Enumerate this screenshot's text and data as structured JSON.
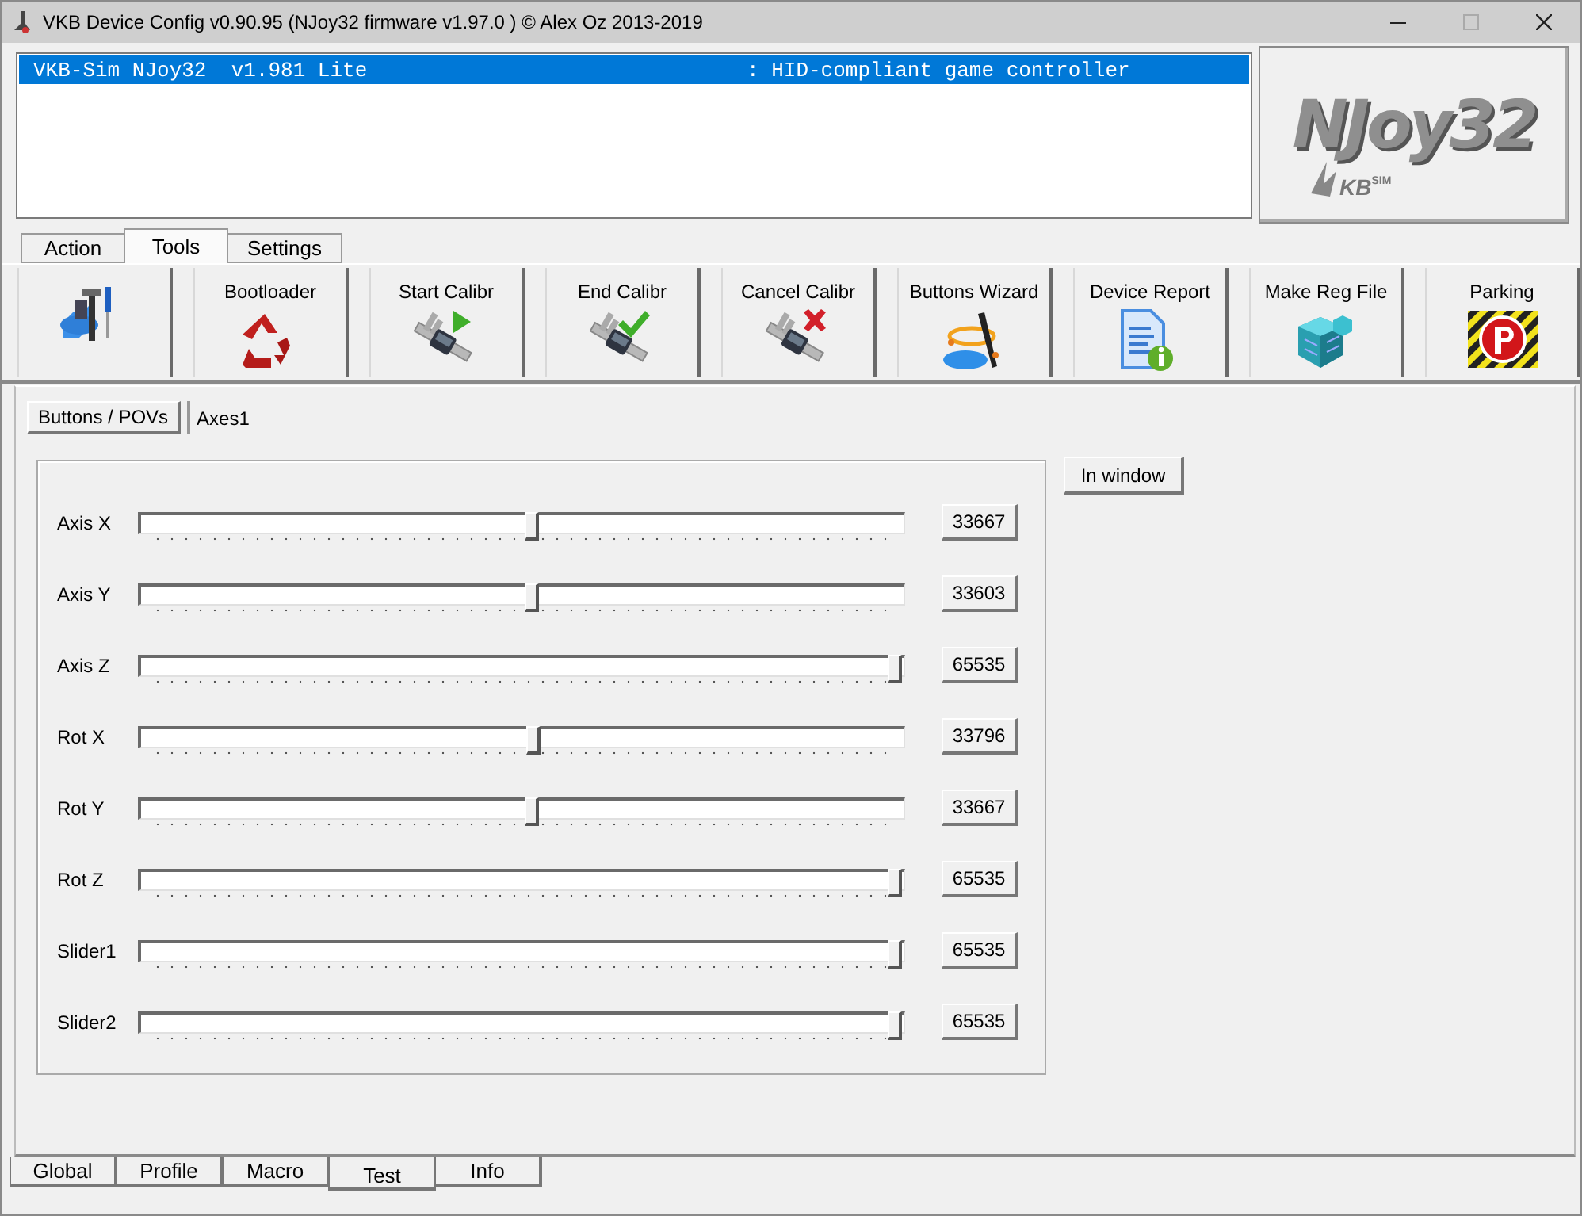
{
  "window": {
    "title": "VKB Device Config v0.90.95 (NJoy32 firmware v1.97.0  ) © Alex Oz 2013-2019"
  },
  "device_list": {
    "rows": [
      {
        "name": "VKB-Sim NJoy32  v1.981 Lite",
        "type": ": HID-compliant game controller",
        "selected": true
      }
    ]
  },
  "logo": {
    "title": "NJoy32",
    "brand": "KB",
    "sub": "SIM"
  },
  "top_tabs": [
    {
      "label": "Action",
      "selected": false
    },
    {
      "label": "Tools",
      "selected": true
    },
    {
      "label": "Settings",
      "selected": false
    }
  ],
  "toolbar": [
    {
      "kind": "tools"
    },
    {
      "kind": "recycle",
      "label": "Bootloader"
    },
    {
      "kind": "start",
      "label": "Start Calibr"
    },
    {
      "kind": "end",
      "label": "End Calibr"
    },
    {
      "kind": "cancel",
      "label": "Cancel Calibr"
    },
    {
      "kind": "wizard",
      "label": "Buttons Wizard"
    },
    {
      "kind": "report",
      "label": "Device Report"
    },
    {
      "kind": "registry",
      "label": "Make Reg File"
    },
    {
      "kind": "parking",
      "label": "Parking"
    }
  ],
  "sub_tabs": [
    {
      "label": "Buttons / POVs",
      "selected": false
    },
    {
      "label": "Axes1",
      "selected": true
    }
  ],
  "axes": [
    {
      "name": "Axis X",
      "level": 0.514,
      "value": "33667"
    },
    {
      "name": "Axis Y",
      "level": 0.513,
      "value": "33603"
    },
    {
      "name": "Axis Z",
      "level": 1,
      "value": "65535"
    },
    {
      "name": "Rot X",
      "level": 0.516,
      "value": "33796"
    },
    {
      "name": "Rot Y",
      "level": 0.514,
      "value": "33667"
    },
    {
      "name": "Rot Z",
      "level": 1,
      "value": "65535"
    },
    {
      "name": "Slider1",
      "level": 1,
      "value": "65535"
    },
    {
      "name": "Slider2",
      "level": 1,
      "value": "65535"
    }
  ],
  "in_window_button": "In window",
  "bottom_tabs": [
    {
      "label": "Global",
      "selected": false
    },
    {
      "label": "Profile",
      "selected": false
    },
    {
      "label": "Macro",
      "selected": false
    },
    {
      "label": "Test",
      "selected": true
    },
    {
      "label": "Info",
      "selected": false
    }
  ]
}
